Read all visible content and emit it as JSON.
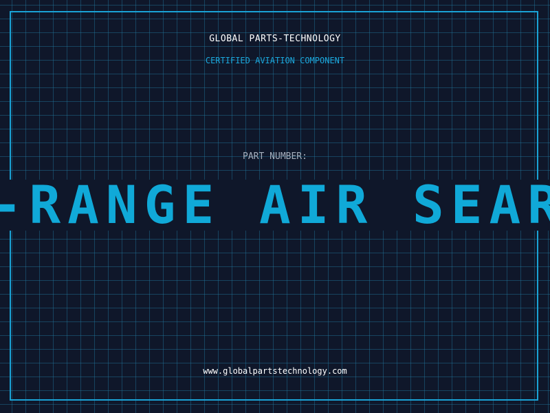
{
  "header": {
    "brand": "GLOBAL PARTS-TECHNOLOGY",
    "subtitle": "CERTIFIED AVIATION COMPONENT"
  },
  "part": {
    "label": "PART NUMBER:",
    "name_visible": "IUM-RANGE AIR SEAR"
  },
  "footer": {
    "website": "www.globalpartstechnology.com"
  },
  "colors": {
    "background": "#0f172a",
    "grid_line": "#22789f",
    "accent": "#10a9d8",
    "text_primary": "#ffffff",
    "text_muted": "#a6b0be"
  }
}
